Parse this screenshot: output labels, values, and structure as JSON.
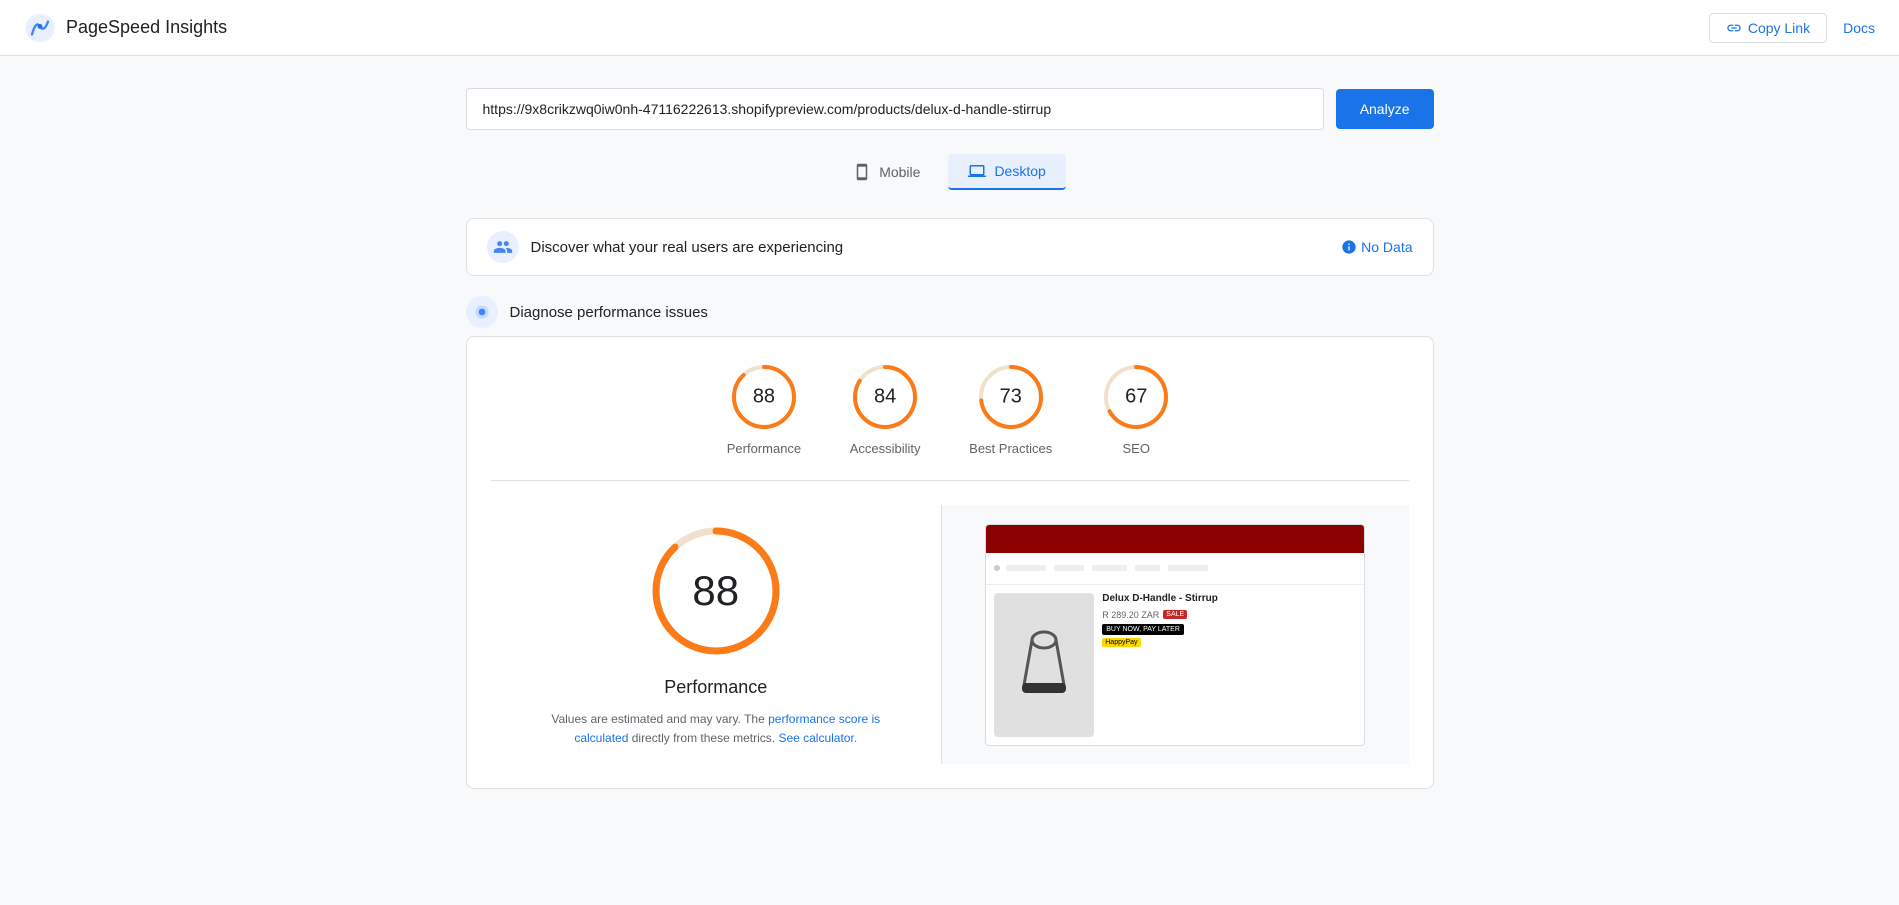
{
  "header": {
    "logo_text": "PageSpeed Insights",
    "copy_link_label": "Copy Link",
    "docs_label": "Docs"
  },
  "url_bar": {
    "url_value": "https://9x8crikzwq0iw0nh-47116222613.shopifypreview.com/products/delux-d-handle-stirrup",
    "analyze_label": "Analyze"
  },
  "tabs": [
    {
      "id": "mobile",
      "label": "Mobile",
      "active": false
    },
    {
      "id": "desktop",
      "label": "Desktop",
      "active": true
    }
  ],
  "sections": {
    "real_users": {
      "title": "Discover what your real users are experiencing",
      "no_data_label": "No Data"
    },
    "diagnose": {
      "title": "Diagnose performance issues"
    }
  },
  "scores": [
    {
      "id": "performance",
      "value": 88,
      "label": "Performance",
      "color": "#fa7b17",
      "bg": "#fde9cf",
      "radius": 30
    },
    {
      "id": "accessibility",
      "value": 84,
      "label": "Accessibility",
      "color": "#fa7b17",
      "bg": "#fde9cf",
      "radius": 30
    },
    {
      "id": "best-practices",
      "value": 73,
      "label": "Best Practices",
      "color": "#fa7b17",
      "bg": "#fde9cf",
      "radius": 30
    },
    {
      "id": "seo",
      "value": 67,
      "label": "SEO",
      "color": "#fa7b17",
      "bg": "#fde9cf",
      "radius": 30
    }
  ],
  "large_score": {
    "value": 88,
    "label": "Performance",
    "color": "#fa7b17",
    "note_prefix": "Values are estimated and may vary. The ",
    "note_link1_label": "performance score is calculated",
    "note_link1_href": "#",
    "note_middle": " directly from these metrics. ",
    "note_link2_label": "See calculator.",
    "note_link2_href": "#"
  },
  "site_thumbnail": {
    "product_title": "Delux D-Handle - Stirrup",
    "price": "R 289.20 ZAR",
    "pay_label": "BUY NOW, PAY LATER"
  }
}
